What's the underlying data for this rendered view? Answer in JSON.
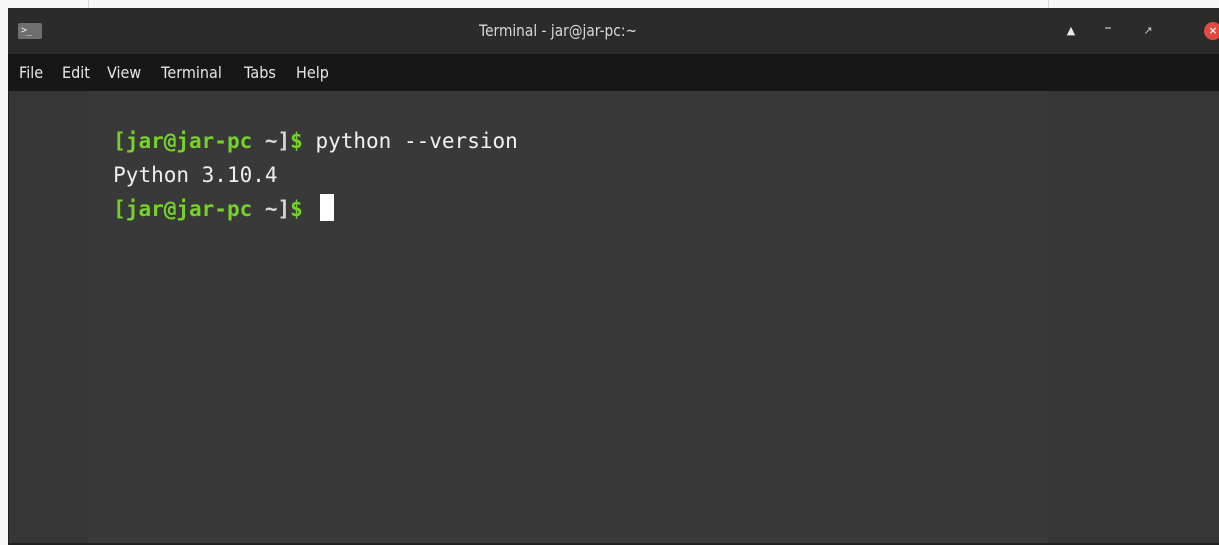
{
  "window": {
    "title": "Terminal - jar@jar-pc:~",
    "app_icon_text": ">_",
    "controls": {
      "up_icon": "▲",
      "minimize_icon": "–",
      "maximize_icon": "↗",
      "close_icon": "×"
    },
    "colors": {
      "title_bg": "#2b2b2b",
      "menu_bg": "#171717",
      "terminal_bg": "#393939",
      "prompt_green": "#77d12b",
      "close_red": "#e14a40"
    }
  },
  "menubar": {
    "items": [
      "File",
      "Edit",
      "View",
      "Terminal",
      "Tabs",
      "Help"
    ]
  },
  "terminal": {
    "lines": [
      {
        "prompt_user": "[jar@jar-pc",
        "prompt_path": " ~]",
        "prompt_symbol": "$",
        "command": " python --version"
      },
      {
        "output": "Python 3.10.4"
      },
      {
        "prompt_user": "[jar@jar-pc",
        "prompt_path": " ~]",
        "prompt_symbol": "$",
        "command": " "
      }
    ]
  }
}
